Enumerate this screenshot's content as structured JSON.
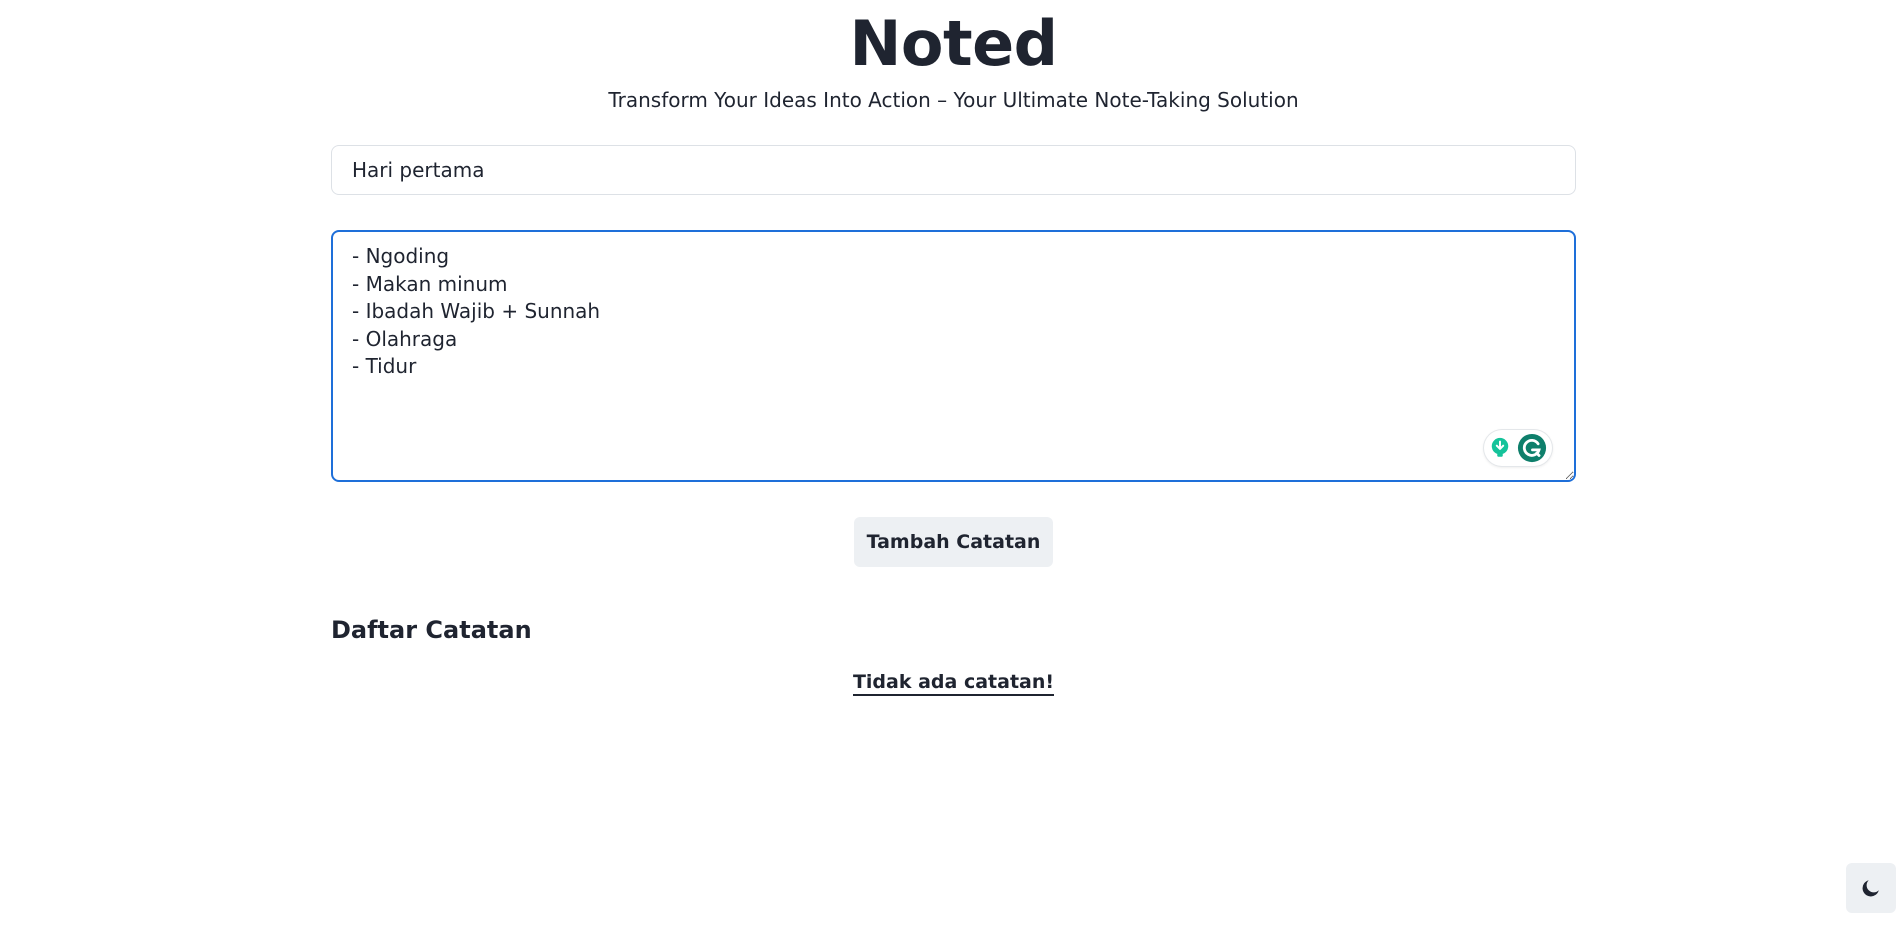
{
  "header": {
    "title": "Noted",
    "subtitle": "Transform Your Ideas Into Action – Your Ultimate Note-Taking Solution"
  },
  "form": {
    "title_input": {
      "value": "Hari pertama"
    },
    "body_textarea": {
      "value": "- Ngoding\n- Makan minum\n- Ibadah Wajib + Sunnah\n- Olahraga\n- Tidur"
    },
    "add_button_label": "Tambah Catatan",
    "grammar_widget_icons": [
      "lightbulb-icon",
      "grammarly-g-icon"
    ]
  },
  "notes_section": {
    "heading": "Daftar Catatan",
    "empty_message": "Tidak ada catatan!"
  },
  "theme_toggle": {
    "icon": "moon-icon"
  },
  "colors": {
    "focus_border": "#1e6fd9",
    "button_bg": "#edf0f3",
    "text": "#1f2430",
    "grammarly_green": "#15c39a",
    "grammarly_dark": "#0e7f6b"
  }
}
